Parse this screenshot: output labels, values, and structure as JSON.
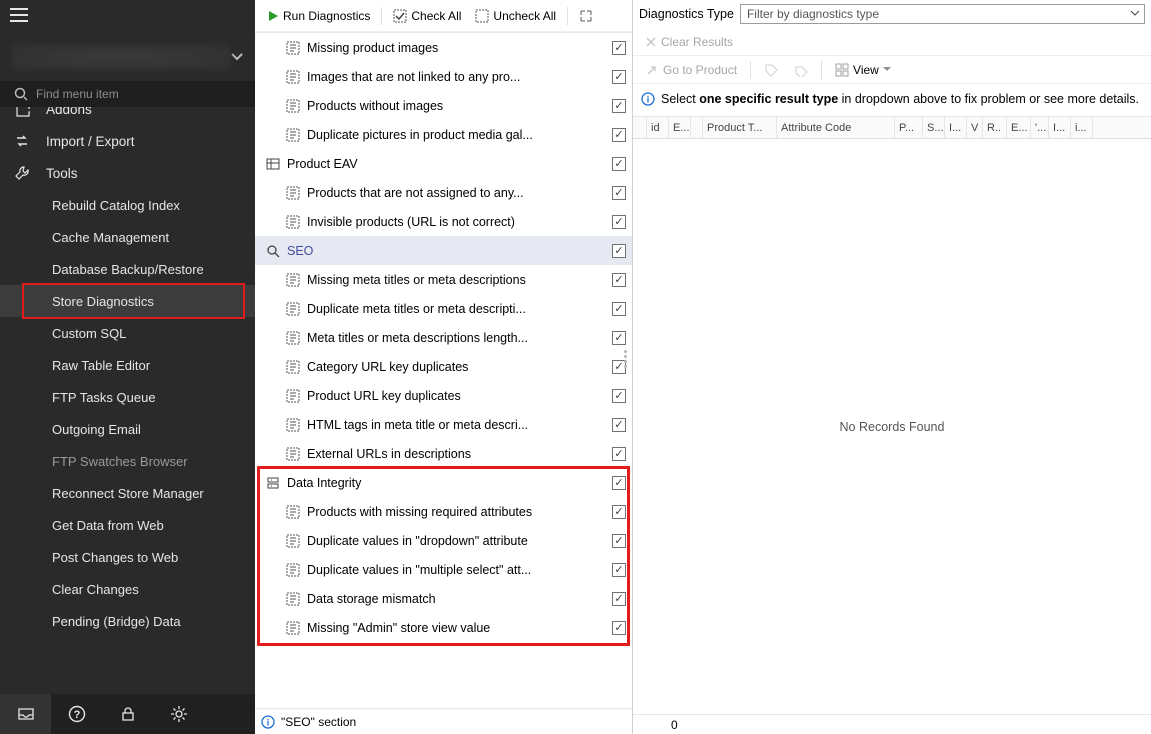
{
  "sidebar": {
    "search_placeholder": "Find menu item",
    "items": [
      {
        "label": "Addons",
        "level": 1,
        "icon": "puzzle",
        "partial": true
      },
      {
        "label": "Import / Export",
        "level": 1,
        "icon": "exchange"
      },
      {
        "label": "Tools",
        "level": 1,
        "icon": "wrench"
      },
      {
        "label": "Rebuild Catalog Index",
        "level": 2
      },
      {
        "label": "Cache Management",
        "level": 2
      },
      {
        "label": "Database Backup/Restore",
        "level": 2
      },
      {
        "label": "Store Diagnostics",
        "level": 2,
        "selected": true,
        "highlight": true
      },
      {
        "label": "Custom SQL",
        "level": 2
      },
      {
        "label": "Raw Table Editor",
        "level": 2
      },
      {
        "label": "FTP Tasks Queue",
        "level": 2
      },
      {
        "label": "Outgoing Email",
        "level": 2
      },
      {
        "label": "FTP Swatches Browser",
        "level": 2,
        "disabled": true
      },
      {
        "label": "Reconnect Store Manager",
        "level": 2
      },
      {
        "label": "Get Data from Web",
        "level": 2
      },
      {
        "label": "Post Changes to Web",
        "level": 2
      },
      {
        "label": "Clear Changes",
        "level": 2
      },
      {
        "label": "Pending (Bridge) Data",
        "level": 2
      }
    ]
  },
  "toolbar": {
    "run": "Run Diagnostics",
    "check_all": "Check All",
    "uncheck_all": "Uncheck All"
  },
  "tree": [
    {
      "type": "diag",
      "label": "Missing product images"
    },
    {
      "type": "diag",
      "label": "Images that are not linked to any pro..."
    },
    {
      "type": "diag",
      "label": "Products without images"
    },
    {
      "type": "diag",
      "label": "Duplicate pictures in product media gal..."
    },
    {
      "type": "cat",
      "label": "Product  EAV"
    },
    {
      "type": "diag",
      "label": "Products that are not assigned to any..."
    },
    {
      "type": "diag",
      "label": "Invisible products (URL is not correct)"
    },
    {
      "type": "cat",
      "label": "SEO",
      "selected": true
    },
    {
      "type": "diag",
      "label": "Missing meta titles or meta descriptions"
    },
    {
      "type": "diag",
      "label": "Duplicate meta titles or meta descripti..."
    },
    {
      "type": "diag",
      "label": "Meta titles or meta descriptions length..."
    },
    {
      "type": "diag",
      "label": "Category URL key duplicates"
    },
    {
      "type": "diag",
      "label": "Product URL key duplicates"
    },
    {
      "type": "diag",
      "label": "HTML tags in meta title or meta descri..."
    },
    {
      "type": "diag",
      "label": "External URLs in descriptions"
    },
    {
      "type": "cat",
      "label": "Data Integrity"
    },
    {
      "type": "diag",
      "label": "Products with missing required attributes"
    },
    {
      "type": "diag",
      "label": "Duplicate values in \"dropdown\" attribute"
    },
    {
      "type": "diag",
      "label": "Duplicate values in \"multiple select\" att..."
    },
    {
      "type": "diag",
      "label": "Data storage mismatch"
    },
    {
      "type": "diag",
      "label": "Missing \"Admin\" store view value"
    }
  ],
  "info_bar": "\"SEO\" section",
  "right": {
    "dg_type_label": "Diagnostics Type",
    "dg_type_placeholder": "Filter by diagnostics type",
    "clear": "Clear Results",
    "goto": "Go to Product",
    "view": "View",
    "hint_pre": "Select ",
    "hint_bold": "one specific result type",
    "hint_post": " in dropdown above to fix problem or see more details.",
    "columns": [
      "",
      "id",
      "E...",
      "",
      "Product T...",
      "Attribute Code",
      "P...",
      "S...",
      "I...",
      "V",
      "R..",
      "E...",
      "'...",
      "I...",
      "i..."
    ],
    "empty": "No Records Found",
    "footer_count": "0"
  }
}
